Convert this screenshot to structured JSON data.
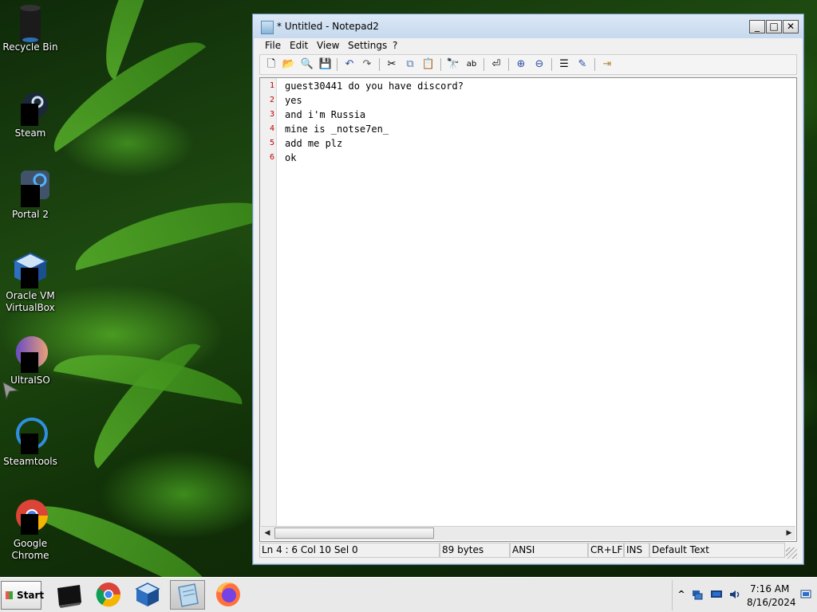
{
  "desktop": {
    "icons": [
      {
        "label": "Recycle Bin",
        "icon": "recycle-bin-icon"
      },
      {
        "label": "Steam",
        "icon": "steam-icon"
      },
      {
        "label": "Portal 2",
        "icon": "portal2-icon"
      },
      {
        "label": "Oracle VM VirtualBox",
        "line1": "Oracle VM",
        "line2": "VirtualBox",
        "icon": "virtualbox-icon"
      },
      {
        "label": "UltraISO",
        "icon": "ultraiso-icon"
      },
      {
        "label": "Steamtools",
        "icon": "steamtools-icon"
      },
      {
        "label": "Google Chrome",
        "line1": "Google",
        "line2": "Chrome",
        "icon": "chrome-icon"
      }
    ]
  },
  "window": {
    "title": "* Untitled - Notepad2",
    "controls": {
      "minimize": "_",
      "maximize": "□",
      "close": "✕"
    },
    "menu": [
      "File",
      "Edit",
      "View",
      "Settings",
      "?"
    ],
    "toolbar_icons": [
      "new-file-icon",
      "open-file-icon",
      "browse-icon",
      "save-icon",
      "undo-icon",
      "redo-icon",
      "cut-icon",
      "copy-icon",
      "paste-icon",
      "find-icon",
      "replace-icon",
      "word-wrap-icon",
      "zoom-in-icon",
      "zoom-out-icon",
      "scheme-icon",
      "customize-scheme-icon",
      "exit-icon"
    ],
    "editor": {
      "lines": [
        {
          "num": "1",
          "text": "guest30441 do you have discord?"
        },
        {
          "num": "2",
          "text": "yes"
        },
        {
          "num": "3",
          "text": "and i'm Russia"
        },
        {
          "num": "4",
          "text": "mine is _notse7en_"
        },
        {
          "num": "5",
          "text": "add me plz"
        },
        {
          "num": "6",
          "text": "ok"
        }
      ]
    },
    "status": {
      "position": "Ln 4 : 6   Col 10   Sel 0",
      "size": "89 bytes",
      "encoding": "ANSI",
      "line_endings": "CR+LF",
      "mode": "INS",
      "scheme": "Default Text"
    }
  },
  "taskbar": {
    "start_label": "Start",
    "apps": [
      "terminal-icon",
      "chrome-icon",
      "virtualbox-icon",
      "notepad2-icon",
      "firefox-icon"
    ],
    "tray": {
      "chevron": "^",
      "icons": [
        "network-icon",
        "display-icon",
        "volume-icon"
      ],
      "time": "7:16 AM",
      "date": "8/16/2024"
    }
  },
  "colors": {
    "line_number": "#c00000",
    "title_bar": "#c6d9ee",
    "taskbar": "#e9e9e9"
  }
}
